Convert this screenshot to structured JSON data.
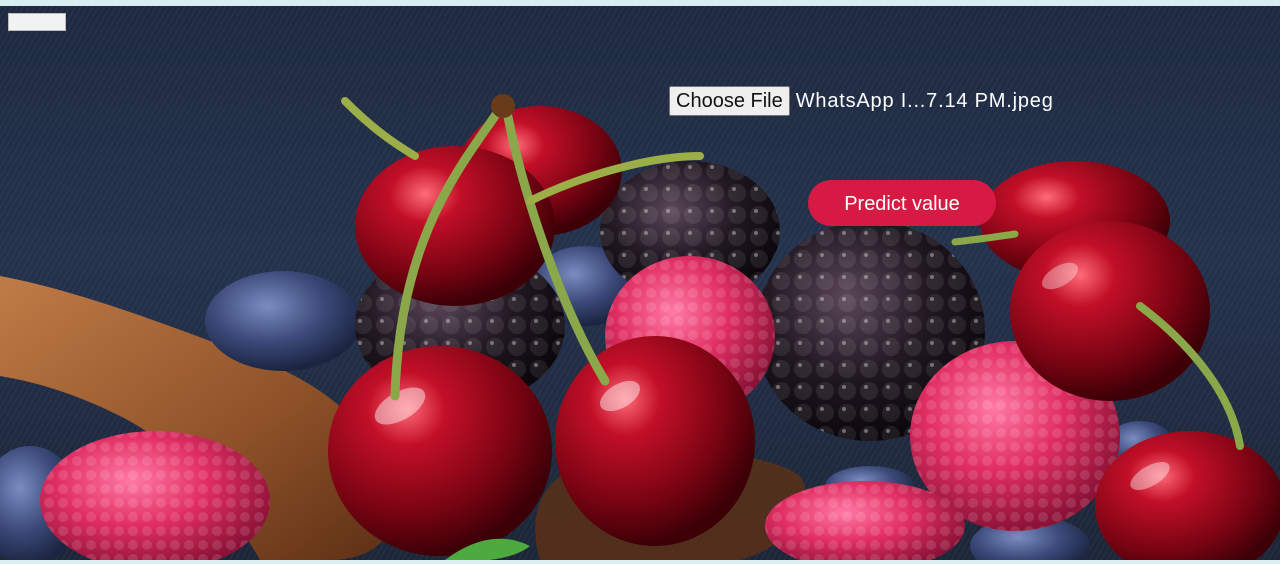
{
  "upload": {
    "choose_label": "Choose File",
    "file_name": "WhatsApp I...7.14 PM.jpeg"
  },
  "actions": {
    "predict_label": "Predict value"
  },
  "background": {
    "subject": "berries-photo"
  },
  "colors": {
    "accent": "#d71a44",
    "page_border": "#d9eef0",
    "background_dark": "#1d2a40"
  }
}
